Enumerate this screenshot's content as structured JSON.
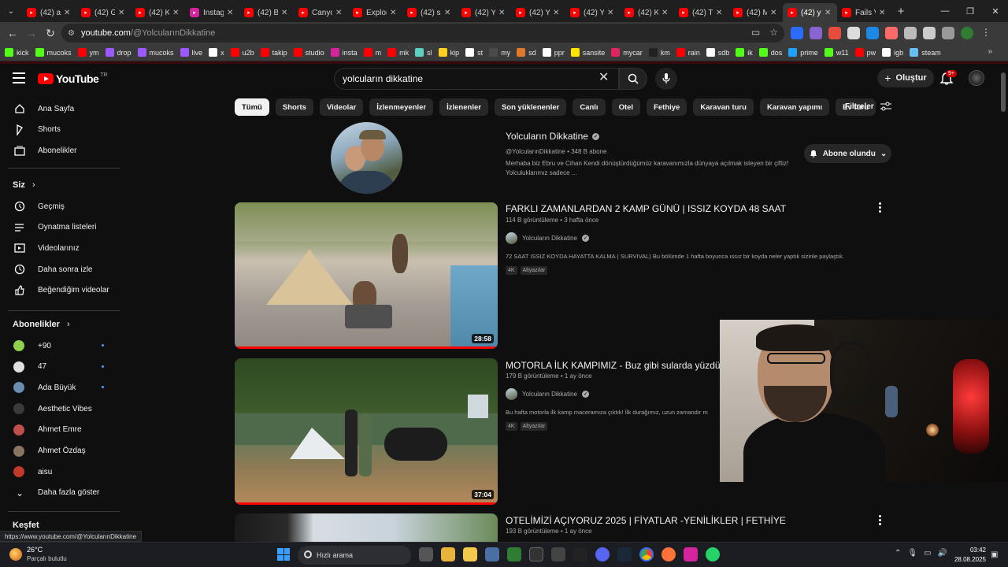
{
  "browser": {
    "tabs": [
      {
        "title": "(42) a",
        "icon": "youtube-icon",
        "color": "#ff0000"
      },
      {
        "title": "(42) G",
        "icon": "youtube-icon",
        "color": "#ff0000"
      },
      {
        "title": "(42) K",
        "icon": "youtube-icon",
        "color": "#ff0000"
      },
      {
        "title": "Instag",
        "icon": "instagram-icon",
        "color": "#d6249f"
      },
      {
        "title": "(42) B",
        "icon": "youtube-icon",
        "color": "#ff0000"
      },
      {
        "title": "Canyo",
        "icon": "youtube-icon",
        "color": "#ff0000"
      },
      {
        "title": "Explor",
        "icon": "youtube-icon",
        "color": "#ff0000"
      },
      {
        "title": "(42) sa",
        "icon": "youtube-icon",
        "color": "#ff0000"
      },
      {
        "title": "(42) Yı",
        "icon": "youtube-icon",
        "color": "#ff0000"
      },
      {
        "title": "(42) Yı",
        "icon": "youtube-icon",
        "color": "#ff0000"
      },
      {
        "title": "(42) Yı",
        "icon": "youtube-icon",
        "color": "#ff0000"
      },
      {
        "title": "(42) K",
        "icon": "youtube-icon",
        "color": "#ff0000"
      },
      {
        "title": "(42) Tİ",
        "icon": "youtube-icon",
        "color": "#ff0000"
      },
      {
        "title": "(42) M",
        "icon": "youtube-icon",
        "color": "#ff0000"
      },
      {
        "title": "(42) y",
        "icon": "youtube-icon",
        "color": "#ff0000",
        "active": true
      },
      {
        "title": "Fails V",
        "icon": "youtube-icon",
        "color": "#ff0000"
      }
    ],
    "url_host": "youtube.com",
    "url_path": "/@YolcularınDikkatine",
    "bookmarks": [
      {
        "label": "kick",
        "color": "#53fc18"
      },
      {
        "label": "mucoks",
        "color": "#53fc18"
      },
      {
        "label": "ym",
        "color": "#ff0000"
      },
      {
        "label": "drop",
        "color": "#9b59ff"
      },
      {
        "label": "mucoks",
        "color": "#9b59ff"
      },
      {
        "label": "live",
        "color": "#9b59ff"
      },
      {
        "label": "x",
        "color": "#ffffff"
      },
      {
        "label": "u2b",
        "color": "#ff0000"
      },
      {
        "label": "takip",
        "color": "#ff0000"
      },
      {
        "label": "studio",
        "color": "#ff0000"
      },
      {
        "label": "insta",
        "color": "#d6249f"
      },
      {
        "label": "m",
        "color": "#ff0000"
      },
      {
        "label": "mk",
        "color": "#ff0000"
      },
      {
        "label": "sl",
        "color": "#5ad1c0"
      },
      {
        "label": "kip",
        "color": "#ffd21f"
      },
      {
        "label": "st",
        "color": "#ffffff"
      },
      {
        "label": "my",
        "color": "#4a4a4a"
      },
      {
        "label": "sd",
        "color": "#e0792a"
      },
      {
        "label": "ppr",
        "color": "#ffffff"
      },
      {
        "label": "sansite",
        "color": "#ffe600"
      },
      {
        "label": "mycar",
        "color": "#e0245e"
      },
      {
        "label": "km",
        "color": "#222222"
      },
      {
        "label": "rain",
        "color": "#ff0000"
      },
      {
        "label": "sdb",
        "color": "#ffffff"
      },
      {
        "label": "ik",
        "color": "#53fc18"
      },
      {
        "label": "dos",
        "color": "#53fc18"
      },
      {
        "label": "prime",
        "color": "#1fa2ff"
      },
      {
        "label": "w11",
        "color": "#53fc18"
      },
      {
        "label": "pw",
        "color": "#ff0000"
      },
      {
        "label": "igb",
        "color": "#ffffff"
      },
      {
        "label": "steam",
        "color": "#66c0f4"
      }
    ]
  },
  "youtube": {
    "logo_text": "YouTube",
    "logo_region": "TR",
    "search_value": "yolcuların dikkatine",
    "create_label": "Oluştur",
    "notif_badge": "9+",
    "sidebar": {
      "main": [
        {
          "label": "Ana Sayfa",
          "icon": "home-icon"
        },
        {
          "label": "Shorts",
          "icon": "shorts-icon"
        },
        {
          "label": "Abonelikler",
          "icon": "subscriptions-icon"
        }
      ],
      "you_heading": "Siz",
      "you": [
        {
          "label": "Geçmiş",
          "icon": "history-icon"
        },
        {
          "label": "Oynatma listeleri",
          "icon": "playlists-icon"
        },
        {
          "label": "Videolarınız",
          "icon": "your-videos-icon"
        },
        {
          "label": "Daha sonra izle",
          "icon": "watch-later-icon"
        },
        {
          "label": "Beğendiğim videolar",
          "icon": "liked-icon"
        }
      ],
      "subs_heading": "Abonelikler",
      "subs": [
        {
          "label": "+90",
          "color": "#8fd14f",
          "dot": true
        },
        {
          "label": "47",
          "color": "#e0e0e0",
          "dot": true
        },
        {
          "label": "Ada Büyük",
          "color": "#6a8caf",
          "dot": true
        },
        {
          "label": "Aesthetic Vibes",
          "color": "#3a3a3a",
          "dot": false
        },
        {
          "label": "Ahmet Emre",
          "color": "#c0504d",
          "dot": false
        },
        {
          "label": "Ahmet Özdaş",
          "color": "#8a7560",
          "dot": false
        },
        {
          "label": "aisu",
          "color": "#c0392b",
          "dot": false
        }
      ],
      "show_more": "Daha fazla göster",
      "explore_heading": "Keşfet"
    },
    "chips": [
      "Tümü",
      "Shorts",
      "Videolar",
      "İzlenmeyenler",
      "İzlenenler",
      "Son yüklenenler",
      "Canlı",
      "Otel",
      "Fethiye",
      "Karavan turu",
      "Karavan yapımı",
      "Ev turu"
    ],
    "filters_label": "Filtreler",
    "channel": {
      "name": "Yolcuların Dikkatine",
      "handle_line": "@YolcularınDikkatine • 348 B abone",
      "description": "Merhaba biz Ebru ve Cihan Kendi dönüştürdüğümüz karavanımızla dünyaya açılmak isteyen bir çiftiz! Yolculuklarımız sadece ...",
      "subscribed_label": "Abone olundu"
    },
    "videos": [
      {
        "title": "FARKLI ZAMANLARDAN 2 KAMP GÜNÜ | ISSIZ KOYDA 48 SAAT",
        "meta": "114 B görüntüleme • 3 hafta önce",
        "channel": "Yolcuların Dikkatine",
        "description": "72 SAAT ISSIZ KOYDA HAYATTA KALMA ( SURVIVAL) Bu bölümde 1 hafta boyunca ıssız bir koyda neler yaptık sizinle paylaştık.",
        "badges": [
          "4K",
          "Altyazılar"
        ],
        "duration": "28:58"
      },
      {
        "title": "MOTORLA İLK KAMPIMIZ - Buz gibi sularda yüzdük",
        "meta": "179 B görüntüleme • 1 ay önce",
        "channel": "Yolcuların Dikkatine",
        "description": "Bu hafta motorla ilk kamp maceramıza çıktık! İlk durağımız, uzun zamandır m",
        "badges": [
          "4K",
          "Altyazılar"
        ],
        "duration": "37:04"
      },
      {
        "title": "OTELİMİZİ AÇIYORUZ 2025 | FİYATLAR -YENİLİKLER | FETHİYE",
        "meta": "193 B görüntüleme • 1 ay önce"
      }
    ]
  },
  "status_url": "https://www.youtube.com/@YolcularınDikkatine",
  "taskbar": {
    "temperature": "26°C",
    "weather": "Parçalı bulutlu",
    "search_placeholder": "Hızlı arama",
    "time": "03:42",
    "date": "28.08.2025"
  }
}
